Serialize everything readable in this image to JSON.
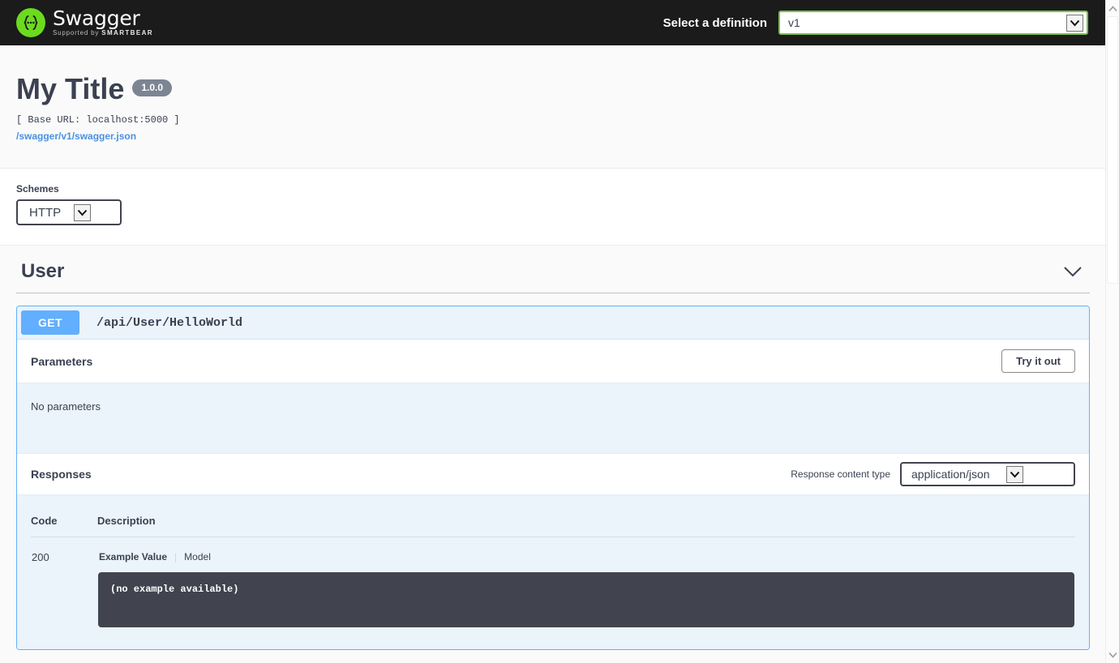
{
  "topbar": {
    "logo_title": "Swagger",
    "logo_sub_prefix": "Supported by ",
    "logo_sub_brand": "SMARTBEAR",
    "definition_label": "Select a definition",
    "definition_value": "v1",
    "definition_border_color": "#7bbf4e",
    "background": "#1b1b1b"
  },
  "info": {
    "title": "My Title",
    "version": "1.0.0",
    "base_url": "[ Base URL: localhost:5000 ]",
    "spec_link": "/swagger/v1/swagger.json"
  },
  "schemes": {
    "label": "Schemes",
    "value": "HTTP"
  },
  "tag": {
    "name": "User",
    "expanded": true
  },
  "operation": {
    "method": "GET",
    "path": "/api/User/HelloWorld",
    "accent_color": "#61affe",
    "parameters": {
      "title": "Parameters",
      "try_it_out_label": "Try it out",
      "empty_text": "No parameters"
    },
    "responses": {
      "title": "Responses",
      "content_type_label": "Response content type",
      "content_type_value": "application/json",
      "columns": [
        "Code",
        "Description"
      ],
      "rows": [
        {
          "code": "200",
          "tab_active": "Example Value",
          "tab_inactive": "Model",
          "example": "(no example available)"
        }
      ]
    }
  },
  "scrollbar": {
    "up_icon": "chevron-up-icon",
    "down_icon": "chevron-down-icon"
  }
}
